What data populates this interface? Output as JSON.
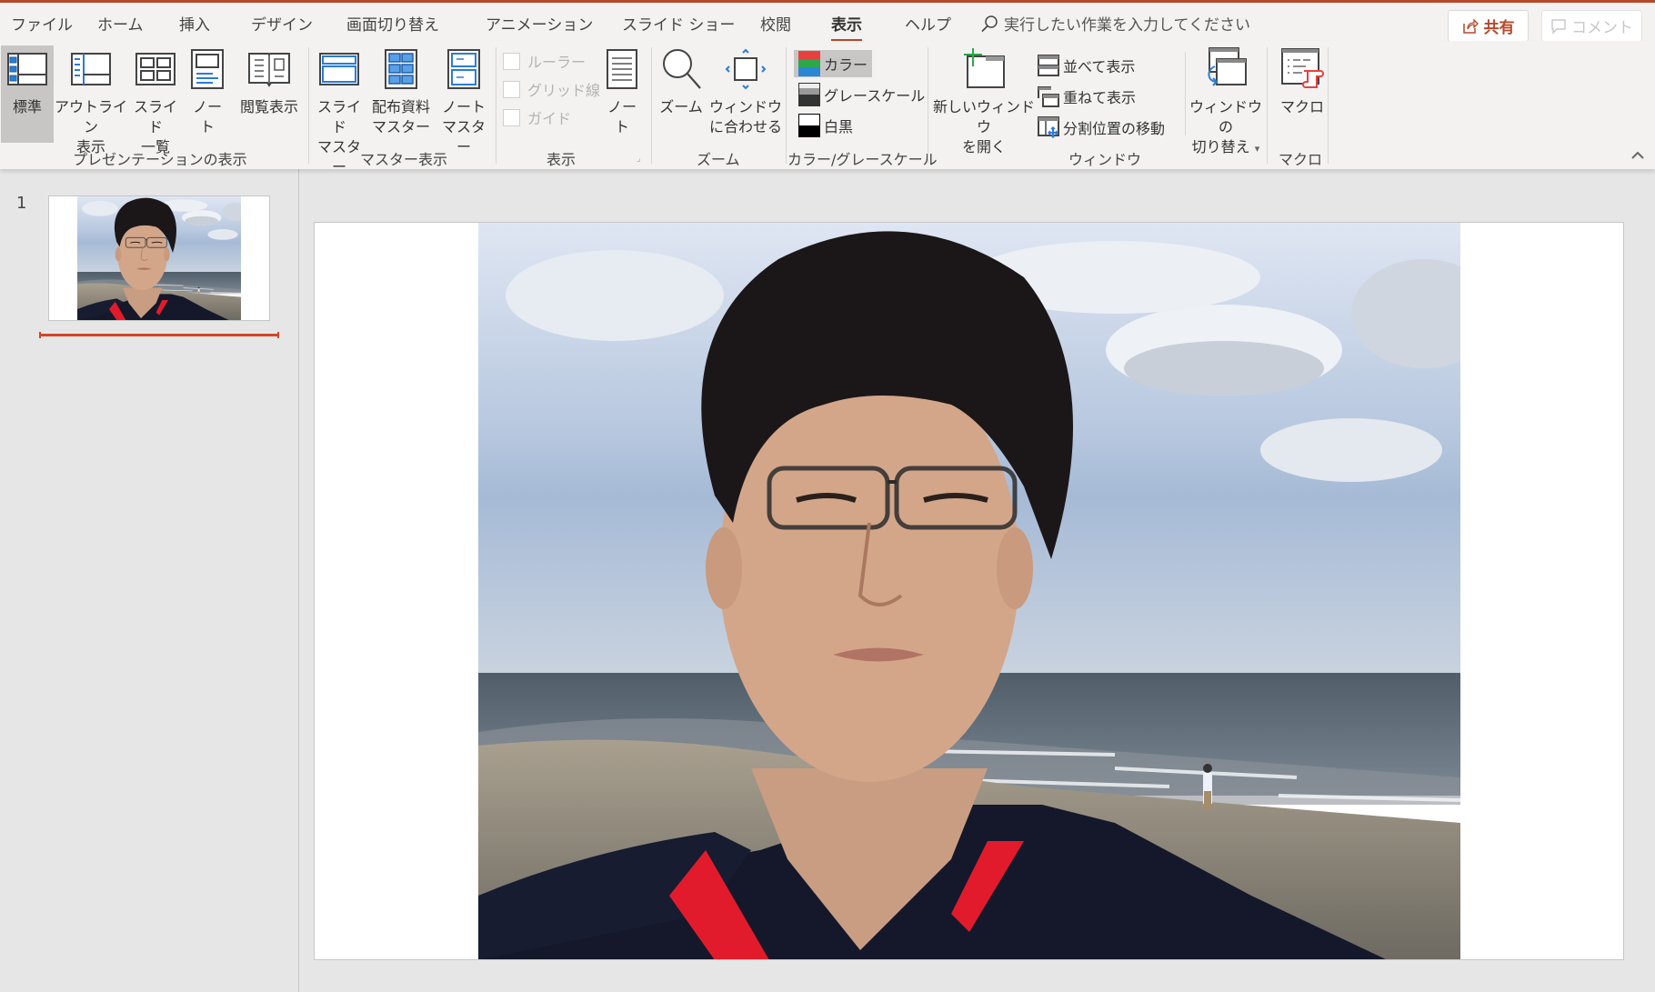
{
  "window": {
    "accent_color": "#b7472a"
  },
  "tabs": [
    {
      "label": "ファイル",
      "active": false
    },
    {
      "label": "ホーム",
      "active": false
    },
    {
      "label": "挿入",
      "active": false
    },
    {
      "label": "デザイン",
      "active": false
    },
    {
      "label": "画面切り替え",
      "active": false
    },
    {
      "label": "アニメーション",
      "active": false
    },
    {
      "label": "スライド ショー",
      "active": false
    },
    {
      "label": "校閲",
      "active": false
    },
    {
      "label": "表示",
      "active": true
    },
    {
      "label": "ヘルプ",
      "active": false
    }
  ],
  "search": {
    "icon": "search-icon",
    "placeholder": "実行したい作業を入力してください"
  },
  "share": {
    "icon": "share-icon",
    "label": "共有"
  },
  "comment": {
    "icon": "comment-icon",
    "label": "コメント"
  },
  "ribbon": {
    "groups": {
      "presentation_views": {
        "label": "プレゼンテーションの表示",
        "buttons": [
          {
            "line1": "標準",
            "line2": "",
            "icon": "normal-view-icon",
            "selected": true
          },
          {
            "line1": "アウトライン",
            "line2": "表示",
            "icon": "outline-view-icon"
          },
          {
            "line1": "スライド",
            "line2": "一覧",
            "icon": "slide-sorter-icon"
          },
          {
            "line1": "ノー",
            "line2": "ト",
            "icon": "notes-page-icon"
          },
          {
            "line1": "閲覧表示",
            "line2": "",
            "icon": "reading-view-icon"
          }
        ]
      },
      "master_views": {
        "label": "マスター表示",
        "buttons": [
          {
            "line1": "スライド",
            "line2": "マスター",
            "icon": "slide-master-icon"
          },
          {
            "line1": "配布資料",
            "line2": "マスター",
            "icon": "handout-master-icon"
          },
          {
            "line1": "ノート",
            "line2": "マスター",
            "icon": "notes-master-icon"
          }
        ]
      },
      "show": {
        "label": "表示",
        "checkboxes": [
          {
            "label": "ルーラー",
            "checked": false,
            "disabled": true
          },
          {
            "label": "グリッド線",
            "checked": false,
            "disabled": true
          },
          {
            "label": "ガイド",
            "checked": false,
            "disabled": true
          }
        ],
        "notes_button": {
          "line1": "ノー",
          "line2": "ト",
          "icon": "notes-icon"
        }
      },
      "zoom": {
        "label": "ズーム",
        "buttons": [
          {
            "line1": "ズーム",
            "line2": "",
            "icon": "zoom-icon"
          },
          {
            "line1": "ウィンドウ",
            "line2": "に合わせる",
            "icon": "fit-to-window-icon"
          }
        ]
      },
      "color": {
        "label": "カラー/グレースケール",
        "items": [
          {
            "label": "カラー",
            "icon": "color-icon",
            "selected": true
          },
          {
            "label": "グレースケール",
            "icon": "grayscale-icon",
            "selected": false
          },
          {
            "label": "白黒",
            "icon": "black-white-icon",
            "selected": false
          }
        ]
      },
      "window": {
        "label": "ウィンドウ",
        "new_window": {
          "line1": "新しいウィンドウ",
          "line2": "を開く",
          "icon": "new-window-icon"
        },
        "items": [
          {
            "label": "並べて表示",
            "icon": "arrange-all-icon"
          },
          {
            "label": "重ねて表示",
            "icon": "cascade-icon"
          },
          {
            "label": "分割位置の移動",
            "icon": "move-split-icon"
          }
        ],
        "switch_windows": {
          "line1": "ウィンドウの",
          "line2": "切り替え",
          "icon": "switch-windows-icon",
          "dropdown": "▾"
        }
      },
      "macros": {
        "label": "マクロ",
        "button": {
          "line1": "マクロ",
          "line2": "",
          "icon": "macros-icon"
        }
      }
    },
    "collapse_icon": "chevron-up-icon"
  },
  "slides_panel": {
    "slides": [
      {
        "number": "1",
        "selected": true
      }
    ]
  },
  "slide": {
    "content": "photo-selfie-at-beach"
  }
}
